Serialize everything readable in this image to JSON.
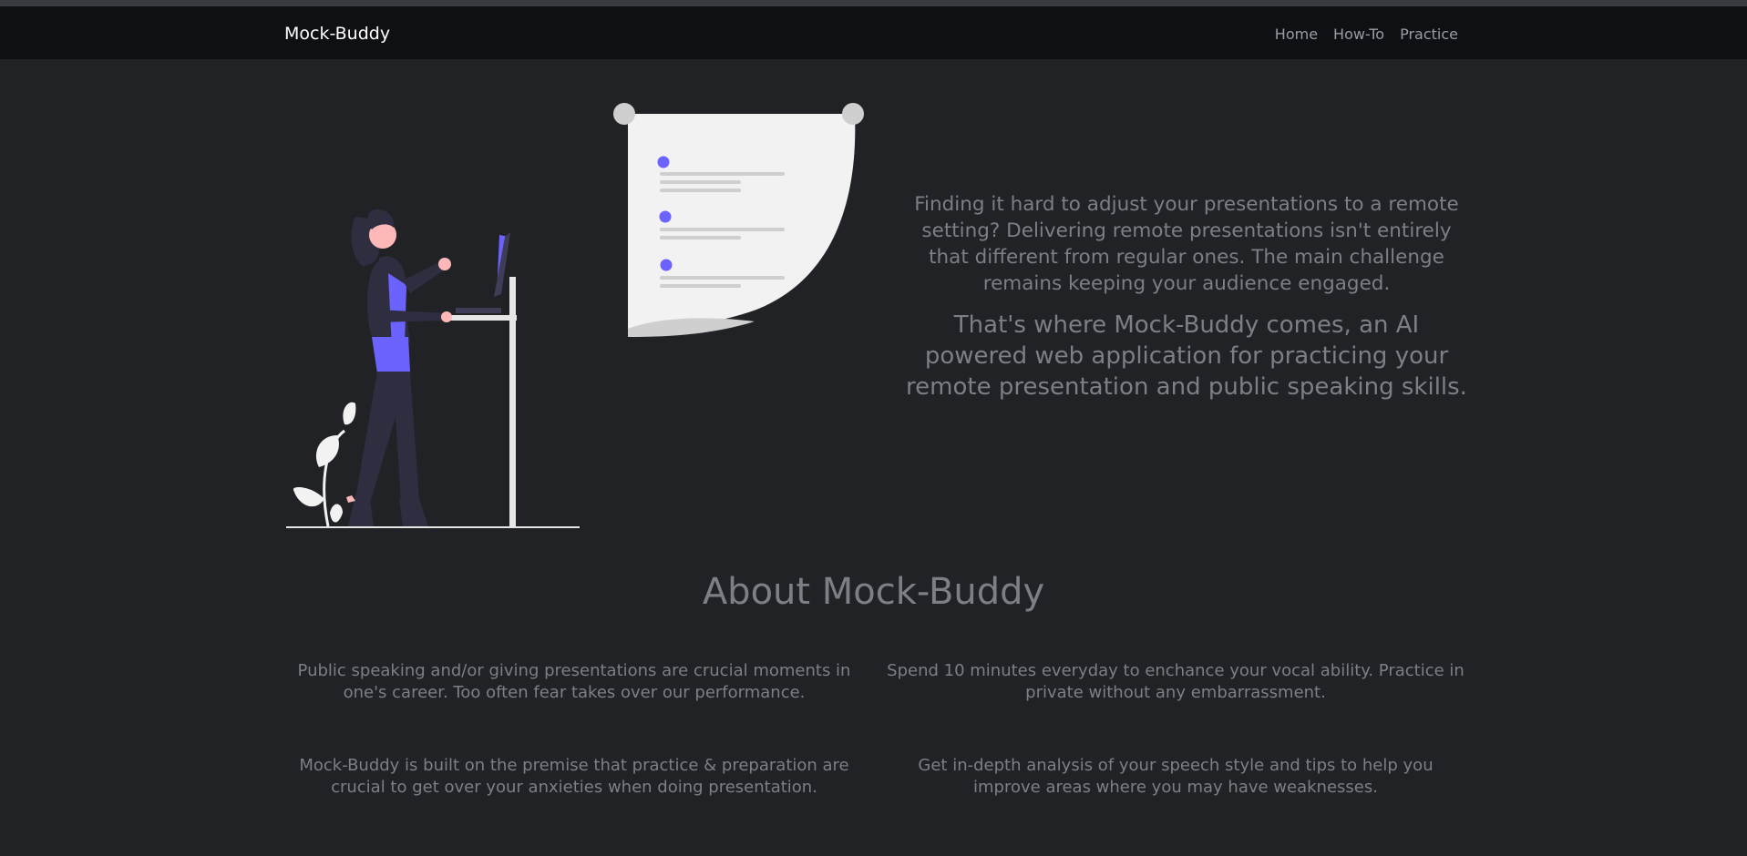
{
  "nav": {
    "brand": "Mock-Buddy",
    "links": [
      "Home",
      "How-To",
      "Practice"
    ]
  },
  "hero": {
    "intro": "Finding it hard to adjust your presentations to a remote setting? Delivering remote presentations isn't entirely that different from regular ones. The main challenge remains keeping your audience engaged.",
    "tagline": "That's where Mock-Buddy comes, an AI powered web application for practicing your remote presentation and public speaking skills."
  },
  "about": {
    "title": "About Mock-Buddy",
    "items": [
      "Public speaking and/or giving presentations are crucial moments in one's career. Too often fear takes over our performance.",
      "Spend 10 minutes everyday to enchance your vocal ability. Practice in private without any embarrassment.",
      "Mock-Buddy is built on the premise that practice & preparation are crucial to get over your anxieties when doing presentation.",
      "Get in-depth analysis of your speech style and tips to help you improve areas where you may have weaknesses."
    ]
  },
  "colors": {
    "background": "#212226",
    "navbar": "#0f1013",
    "accent": "#6c63ff",
    "text_muted": "#7d7f84"
  }
}
